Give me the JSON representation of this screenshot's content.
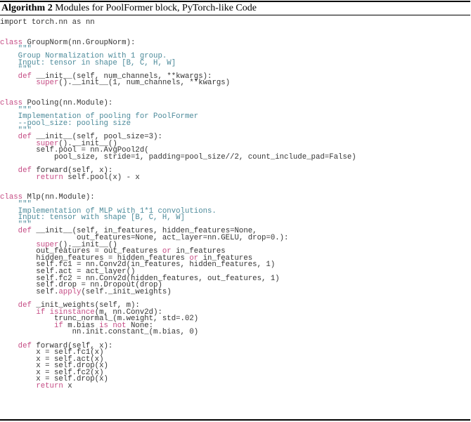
{
  "caption": {
    "label": "Algorithm 2",
    "title": "Modules for PoolFormer block, PyTorch-like Code"
  },
  "colors": {
    "keyword": "#c54b84",
    "docstring": "#4c8a9a",
    "text": "#333333"
  },
  "code_lines": [
    [
      [
        "t",
        "import torch.nn as nn"
      ]
    ],
    [],
    [],
    [
      [
        "k",
        "class"
      ],
      [
        "t",
        " GroupNorm(nn.GroupNorm):"
      ]
    ],
    [
      [
        "d",
        "    \"\"\""
      ]
    ],
    [
      [
        "d",
        "    Group Normalization with 1 group."
      ]
    ],
    [
      [
        "d",
        "    Input: tensor in shape [B, C, H, W]"
      ]
    ],
    [
      [
        "d",
        "    \"\"\""
      ]
    ],
    [
      [
        "t",
        "    "
      ],
      [
        "k",
        "def"
      ],
      [
        "t",
        " __init__(self, num_channels, **kwargs):"
      ]
    ],
    [
      [
        "t",
        "        "
      ],
      [
        "k",
        "super"
      ],
      [
        "t",
        "().__init__(1, num_channels, **kwargs)"
      ]
    ],
    [],
    [],
    [
      [
        "k",
        "class"
      ],
      [
        "t",
        " Pooling(nn.Module):"
      ]
    ],
    [
      [
        "d",
        "    \"\"\""
      ]
    ],
    [
      [
        "d",
        "    Implementation of pooling for PoolFormer"
      ]
    ],
    [
      [
        "d",
        "    --pool_size: pooling size"
      ]
    ],
    [
      [
        "d",
        "    \"\"\""
      ]
    ],
    [
      [
        "t",
        "    "
      ],
      [
        "k",
        "def"
      ],
      [
        "t",
        " __init__(self, pool_size=3):"
      ]
    ],
    [
      [
        "t",
        "        "
      ],
      [
        "k",
        "super"
      ],
      [
        "t",
        "().__init__()"
      ]
    ],
    [
      [
        "t",
        "        self.pool = nn.AvgPool2d("
      ]
    ],
    [
      [
        "t",
        "            pool_size, stride=1, padding=pool_size//2, count_include_pad=False)"
      ]
    ],
    [],
    [
      [
        "t",
        "    "
      ],
      [
        "k",
        "def"
      ],
      [
        "t",
        " forward(self, x):"
      ]
    ],
    [
      [
        "t",
        "        "
      ],
      [
        "k",
        "return"
      ],
      [
        "t",
        " self.pool(x) - x"
      ]
    ],
    [],
    [],
    [
      [
        "k",
        "class"
      ],
      [
        "t",
        " Mlp(nn.Module):"
      ]
    ],
    [
      [
        "d",
        "    \"\"\""
      ]
    ],
    [
      [
        "d",
        "    Implementation of MLP with 1*1 convolutions."
      ]
    ],
    [
      [
        "d",
        "    Input: tensor with shape [B, C, H, W]"
      ]
    ],
    [
      [
        "d",
        "    \"\"\""
      ]
    ],
    [
      [
        "t",
        "    "
      ],
      [
        "k",
        "def"
      ],
      [
        "t",
        " __init__(self, in_features, hidden_features=None,"
      ]
    ],
    [
      [
        "t",
        "                 out_features=None, act_layer=nn.GELU, drop=0.):"
      ]
    ],
    [
      [
        "t",
        "        "
      ],
      [
        "k",
        "super"
      ],
      [
        "t",
        "().__init__()"
      ]
    ],
    [
      [
        "t",
        "        out_features = out_features "
      ],
      [
        "k",
        "or"
      ],
      [
        "t",
        " in_features"
      ]
    ],
    [
      [
        "t",
        "        hidden_features = hidden_features "
      ],
      [
        "k",
        "or"
      ],
      [
        "t",
        " in_features"
      ]
    ],
    [
      [
        "t",
        "        self.fc1 = nn.Conv2d(in_features, hidden_features, 1)"
      ]
    ],
    [
      [
        "t",
        "        self.act = act_layer()"
      ]
    ],
    [
      [
        "t",
        "        self.fc2 = nn.Conv2d(hidden_features, out_features, 1)"
      ]
    ],
    [
      [
        "t",
        "        self.drop = nn.Dropout(drop)"
      ]
    ],
    [
      [
        "t",
        "        self."
      ],
      [
        "k",
        "apply"
      ],
      [
        "t",
        "(self._init_weights)"
      ]
    ],
    [],
    [
      [
        "t",
        "    "
      ],
      [
        "k",
        "def"
      ],
      [
        "t",
        " _init_weights(self, m):"
      ]
    ],
    [
      [
        "t",
        "        "
      ],
      [
        "k",
        "if"
      ],
      [
        "t",
        " "
      ],
      [
        "k",
        "isinstance"
      ],
      [
        "t",
        "(m, nn.Conv2d):"
      ]
    ],
    [
      [
        "t",
        "            trunc_normal_(m.weight, std=.02)"
      ]
    ],
    [
      [
        "t",
        "            "
      ],
      [
        "k",
        "if"
      ],
      [
        "t",
        " m.bias "
      ],
      [
        "k",
        "is not"
      ],
      [
        "t",
        " None:"
      ]
    ],
    [
      [
        "t",
        "                nn.init.constant_(m.bias, 0)"
      ]
    ],
    [],
    [
      [
        "t",
        "    "
      ],
      [
        "k",
        "def"
      ],
      [
        "t",
        " forward(self, x):"
      ]
    ],
    [
      [
        "t",
        "        x = self.fc1(x)"
      ]
    ],
    [
      [
        "t",
        "        x = self.act(x)"
      ]
    ],
    [
      [
        "t",
        "        x = self.drop(x)"
      ]
    ],
    [
      [
        "t",
        "        x = self.fc2(x)"
      ]
    ],
    [
      [
        "t",
        "        x = self.drop(x)"
      ]
    ],
    [
      [
        "t",
        "        "
      ],
      [
        "k",
        "return"
      ],
      [
        "t",
        " x"
      ]
    ]
  ]
}
